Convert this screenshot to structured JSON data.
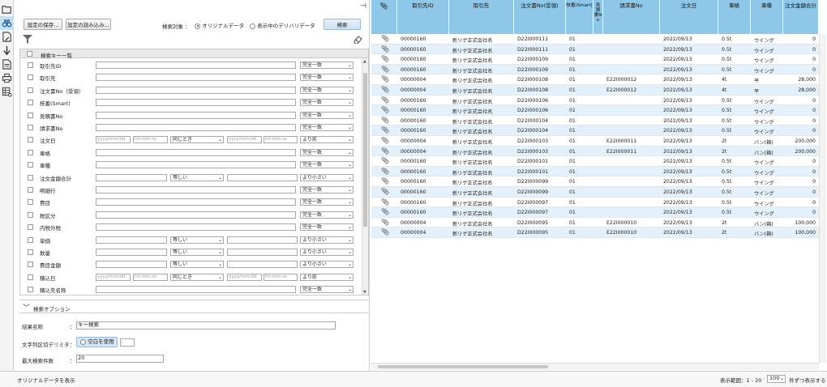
{
  "toolbar": {
    "icons": [
      "folder-icon",
      "binoculars-icon",
      "edit-document-icon",
      "arrow-down-icon",
      "document-export-icon",
      "print-icon",
      "settings-grid-icon"
    ]
  },
  "left": {
    "save_label": "設定の保存...",
    "load_label": "設定の読み込み...",
    "target_label": "検索対象",
    "colon": "：",
    "opt_original": "オリジナルデータ",
    "opt_delivery": "表示中のデリバリデータ",
    "search_label": "検索",
    "grid_header": "検索キー一覧",
    "rows": [
      {
        "label": "取引先ID",
        "type": "text",
        "sel": "完全一致"
      },
      {
        "label": "取引先",
        "type": "text",
        "sel": "完全一致"
      },
      {
        "label": "注文書No（受領）",
        "type": "text",
        "sel": "完全一致"
      },
      {
        "label": "枝番(Smart)",
        "type": "text",
        "sel": "完全一致"
      },
      {
        "label": "見積書No",
        "type": "text",
        "sel": "完全一致"
      },
      {
        "label": "請求書No",
        "type": "text",
        "sel": "完全一致"
      },
      {
        "label": "注文日",
        "type": "date",
        "d1": "yyyy/mm/dd",
        "t1": "hh:mm:ss",
        "mid": "同じとき",
        "d2": "yyyy/mm/dd",
        "t2": "hh:mm:ss",
        "sel": "より前"
      },
      {
        "label": "車格",
        "type": "text",
        "sel": "完全一致"
      },
      {
        "label": "車種",
        "type": "text",
        "sel": "完全一致"
      },
      {
        "label": "注文金額合計",
        "type": "num",
        "mid": "等しい",
        "sel": "より小さい"
      },
      {
        "label": "明細行",
        "type": "text",
        "sel": "完全一致"
      },
      {
        "label": "費目",
        "type": "text",
        "sel": "完全一致"
      },
      {
        "label": "税区分",
        "type": "text",
        "sel": "完全一致"
      },
      {
        "label": "内税外税",
        "type": "text",
        "sel": "完全一致"
      },
      {
        "label": "単価",
        "type": "num",
        "mid": "等しい",
        "sel": "より小さい"
      },
      {
        "label": "数量",
        "type": "num",
        "mid": "等しい",
        "sel": "より小さい"
      },
      {
        "label": "費目金額",
        "type": "num",
        "mid": "等しい",
        "sel": "より小さい"
      },
      {
        "label": "積込日",
        "type": "date",
        "d1": "yyyy/mm/dd",
        "t1": "hh:mm:ss",
        "mid": "同じとき",
        "d2": "yyyy/mm/dd",
        "t2": "hh:mm:ss",
        "sel": "より前"
      },
      {
        "label": "積込先名称",
        "type": "text",
        "sel": "完全一致"
      }
    ],
    "options_title": "検索オプション",
    "name_label": "結果名称",
    "name_value": "キー検索",
    "delim_label": "文字列区切デリミタ",
    "delim_btn": "空白を使用",
    "delim_value": ",",
    "max_label": "最大検索件数",
    "max_value": "20"
  },
  "status": {
    "left": "オリジナルデータを表示",
    "range": "表示範囲：1 - 20",
    "per_page": "100",
    "per_suffix": "件ずつ表示する"
  },
  "table": {
    "columns": [
      "取引先ID",
      "取引先",
      "注文書No(受領)",
      "枝番(Smart)",
      "見積書No",
      "請求書No",
      "注文日",
      "車格",
      "車種",
      "注文金額合計"
    ],
    "rows": [
      [
        "00000160",
        "新リゲ正式会社名",
        "D22I000111",
        "01",
        "",
        "",
        "2022/09/13",
        "0.5t",
        "ウイング",
        "0"
      ],
      [
        "00000160",
        "新リゲ正式会社名",
        "D22I000111",
        "01",
        "",
        "",
        "2022/09/13",
        "0.5t",
        "ウイング",
        "0"
      ],
      [
        "00000160",
        "新リゲ正式会社名",
        "D22I000109",
        "01",
        "",
        "",
        "2022/09/13",
        "0.5t",
        "ウイング",
        "0"
      ],
      [
        "00000160",
        "新リゲ正式会社名",
        "D22I000109",
        "01",
        "",
        "",
        "2022/09/13",
        "0.5t",
        "ウイング",
        "0"
      ],
      [
        "00000004",
        "新リゲ正式会社名",
        "D22I000108",
        "01",
        "",
        "E22I000012",
        "2022/09/13",
        "4t",
        "平",
        "28,000"
      ],
      [
        "00000004",
        "新リゲ正式会社名",
        "D22I000108",
        "01",
        "",
        "E22I000012",
        "2022/09/13",
        "4t",
        "平",
        "28,000"
      ],
      [
        "00000160",
        "新リゲ正式会社名",
        "D22I000106",
        "01",
        "",
        "",
        "2022/09/13",
        "0.5t",
        "ウイング",
        "0"
      ],
      [
        "00000160",
        "新リゲ正式会社名",
        "D22I000106",
        "01",
        "",
        "",
        "2022/09/13",
        "0.5t",
        "ウイング",
        "0"
      ],
      [
        "00000160",
        "新リゲ正式会社名",
        "D22I000104",
        "01",
        "",
        "",
        "2022/09/13",
        "0.5t",
        "ウイング",
        "0"
      ],
      [
        "00000160",
        "新リゲ正式会社名",
        "D22I000104",
        "01",
        "",
        "",
        "2022/09/13",
        "0.5t",
        "ウイング",
        "0"
      ],
      [
        "00000004",
        "新リゲ正式会社名",
        "D22I000103",
        "01",
        "",
        "E22I000011",
        "2022/09/13",
        "2t",
        "バン(箱)",
        "200,000"
      ],
      [
        "00000004",
        "新リゲ正式会社名",
        "D22I000103",
        "01",
        "",
        "E22I000011",
        "2022/09/13",
        "2t",
        "バン(箱)",
        "200,000"
      ],
      [
        "00000160",
        "新リゲ正式会社名",
        "D22I000101",
        "01",
        "",
        "",
        "2022/09/13",
        "0.5t",
        "ウイング",
        "0"
      ],
      [
        "00000160",
        "新リゲ正式会社名",
        "D22I000101",
        "01",
        "",
        "",
        "2022/09/13",
        "0.5t",
        "ウイング",
        "0"
      ],
      [
        "00000160",
        "新リゲ正式会社名",
        "D22I000099",
        "01",
        "",
        "",
        "2022/09/13",
        "0.5t",
        "ウイング",
        "0"
      ],
      [
        "00000160",
        "新リゲ正式会社名",
        "D22I000099",
        "01",
        "",
        "",
        "2022/09/13",
        "0.5t",
        "ウイング",
        "0"
      ],
      [
        "00000160",
        "新リゲ正式会社名",
        "D22I000097",
        "01",
        "",
        "",
        "2022/09/13",
        "0.5t",
        "ウイング",
        "0"
      ],
      [
        "00000160",
        "新リゲ正式会社名",
        "D22I000097",
        "01",
        "",
        "",
        "2022/09/13",
        "0.5t",
        "ウイング",
        "0"
      ],
      [
        "00000004",
        "新リゲ正式会社名",
        "D22I000095",
        "01",
        "",
        "E22I000010",
        "2022/09/13",
        "2t",
        "バン(箱)",
        "100,000"
      ],
      [
        "00000004",
        "新リゲ正式会社名",
        "D22I000095",
        "01",
        "",
        "E22I000010",
        "2022/09/13",
        "2t",
        "バン(箱)",
        "100,000"
      ]
    ]
  },
  "colors": {
    "header_bg": "#8ec7e8",
    "alt_row": "#e4f1fa",
    "active_tool": "#c6dff2"
  }
}
